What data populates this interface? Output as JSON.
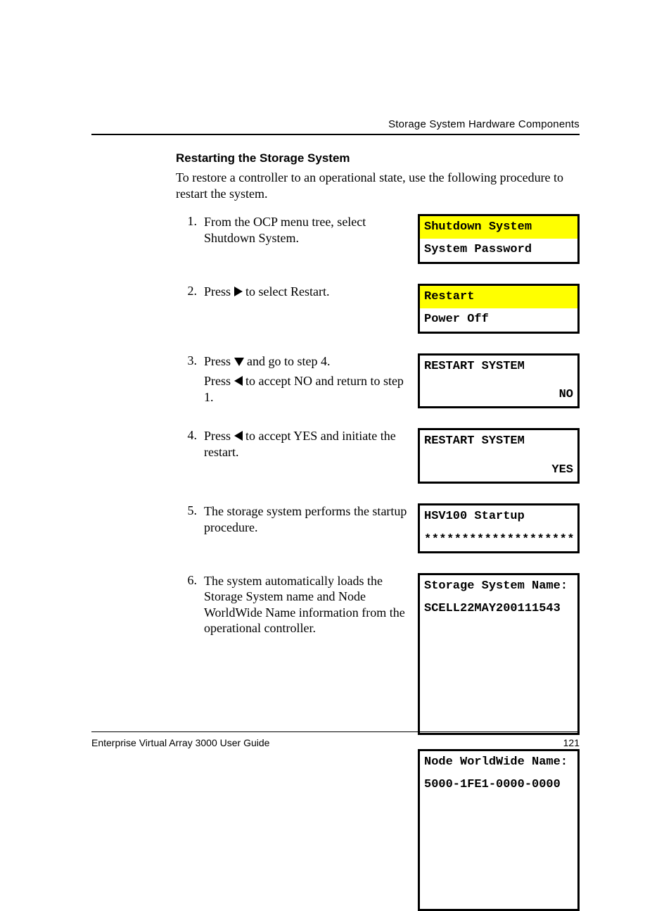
{
  "header": {
    "right": "Storage System Hardware Components"
  },
  "section": {
    "title": "Restarting the Storage System",
    "intro": "To restore a controller to an operational state, use the following procedure to restart the system."
  },
  "steps": [
    {
      "num": "1.",
      "text_pre": "From the OCP menu tree, select Shutdown System.",
      "ocp": [
        {
          "text": "Shutdown System",
          "hl": true
        },
        {
          "text": "System Password"
        }
      ]
    },
    {
      "num": "2.",
      "text_pre": "Press ",
      "icon": "right",
      "text_post": " to select Restart.",
      "ocp": [
        {
          "text": "Restart",
          "hl": true
        },
        {
          "text": "Power Off"
        }
      ]
    },
    {
      "num": "3.",
      "line1_pre": "Press ",
      "line1_icon": "down",
      "line1_post": " and go to step 4.",
      "line2_pre": "Press ",
      "line2_icon": "left",
      "line2_post": " to accept NO and return to step 1.",
      "ocp": [
        {
          "text": "RESTART SYSTEM"
        },
        {
          "text": "NO",
          "right": true
        }
      ]
    },
    {
      "num": "4.",
      "text_pre": "Press ",
      "icon": "left",
      "text_post": " to accept YES and initiate the restart.",
      "ocp": [
        {
          "text": "RESTART SYSTEM"
        },
        {
          "text": "YES",
          "right": true
        }
      ]
    },
    {
      "num": "5.",
      "text_pre": "The storage system performs the startup procedure.",
      "ocp": [
        {
          "text": "HSV100 Startup"
        },
        {
          "text": "********************",
          "wide": true
        }
      ]
    },
    {
      "num": "6.",
      "text_pre": "The system automatically loads the Storage System name and Node WorldWide Name information from the operational controller.",
      "ocp": [
        {
          "text": "Storage System Name:"
        },
        {
          "text": "SCELL22MAY200111543"
        }
      ],
      "ocp_extra": [
        {
          "text": "Node WorldWide Name:"
        },
        {
          "text": "5000-1FE1-0000-0000"
        }
      ]
    }
  ],
  "footer": {
    "left": "Enterprise Virtual Array 3000 User Guide",
    "right": "121"
  }
}
